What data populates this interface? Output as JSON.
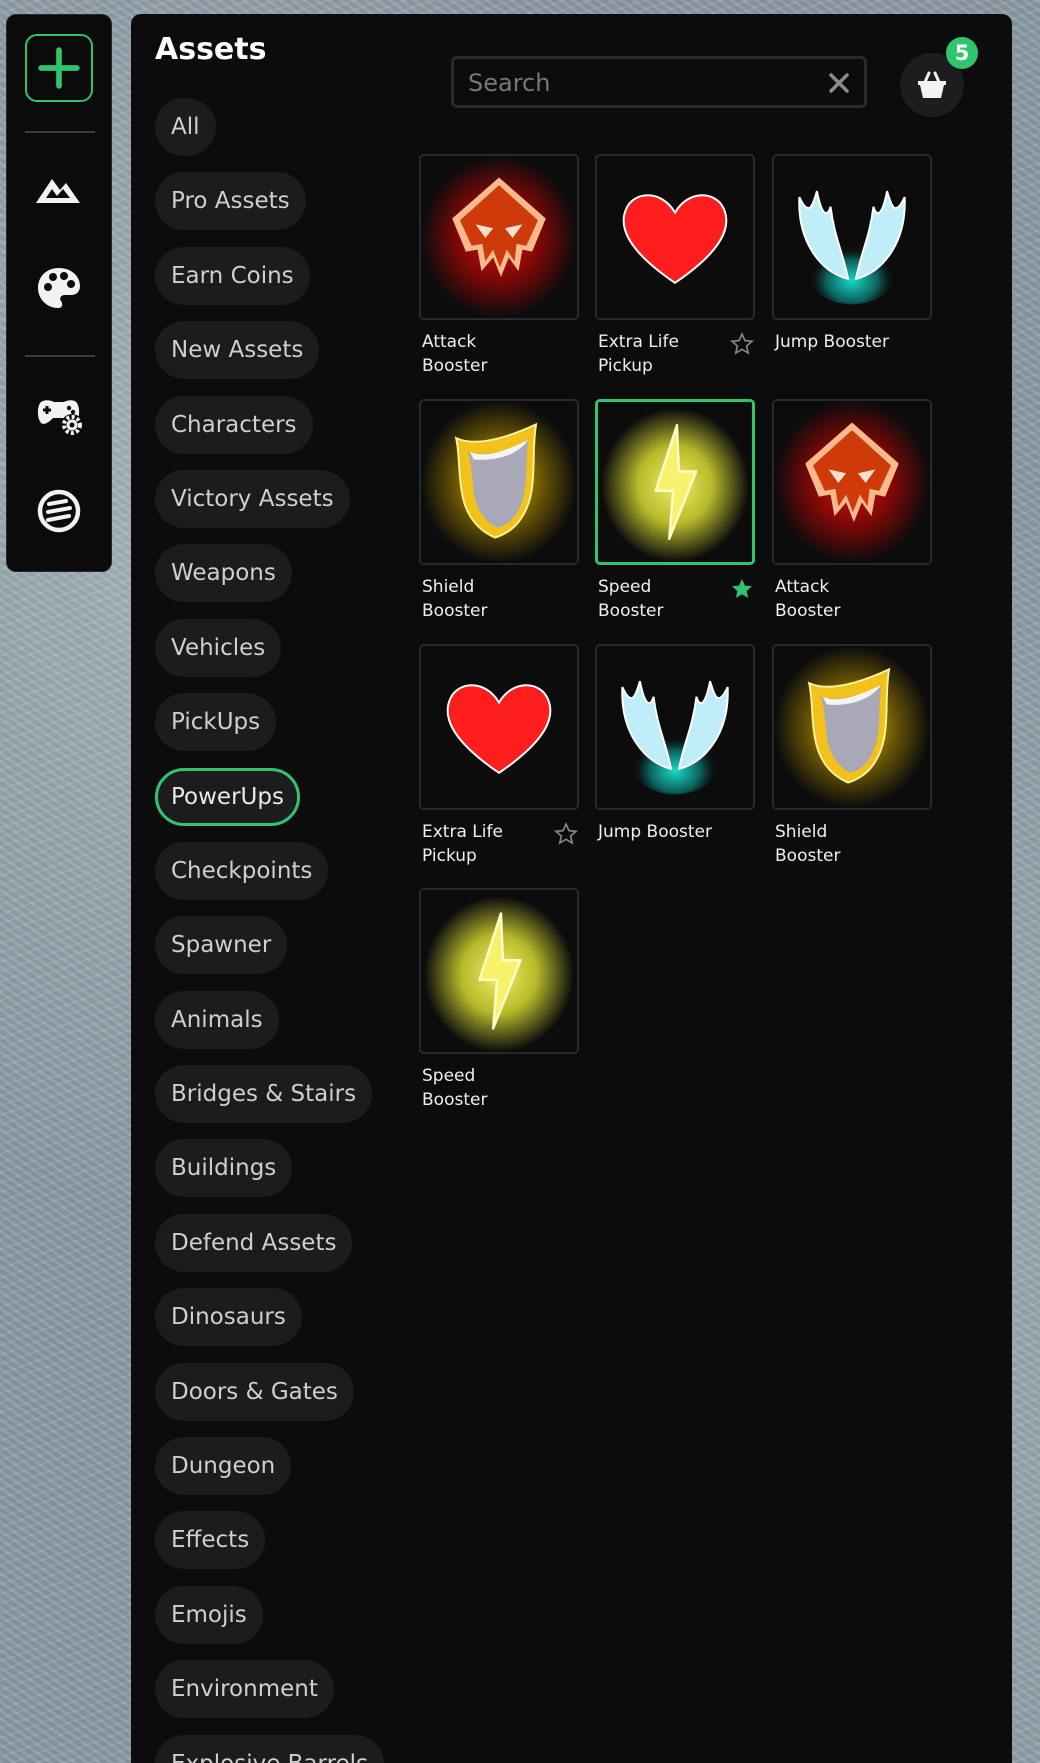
{
  "panel": {
    "title": "Assets"
  },
  "toolbar": {
    "items": [
      {
        "name": "add",
        "icon": "plus-icon"
      },
      {
        "name": "terrain",
        "icon": "mountain-icon"
      },
      {
        "name": "paint",
        "icon": "palette-icon"
      },
      {
        "name": "game-settings",
        "icon": "gamepad-gear-icon"
      },
      {
        "name": "logic",
        "icon": "striped-circle-icon"
      }
    ]
  },
  "categories": [
    {
      "label": "All"
    },
    {
      "label": "Pro Assets"
    },
    {
      "label": "Earn Coins"
    },
    {
      "label": "New Assets"
    },
    {
      "label": "Characters"
    },
    {
      "label": "Victory Assets"
    },
    {
      "label": "Weapons"
    },
    {
      "label": "Vehicles"
    },
    {
      "label": "PickUps"
    },
    {
      "label": "PowerUps",
      "active": true
    },
    {
      "label": "Checkpoints"
    },
    {
      "label": "Spawner"
    },
    {
      "label": "Animals"
    },
    {
      "label": "Bridges & Stairs"
    },
    {
      "label": "Buildings"
    },
    {
      "label": "Defend Assets"
    },
    {
      "label": "Dinosaurs"
    },
    {
      "label": "Doors & Gates"
    },
    {
      "label": "Dungeon"
    },
    {
      "label": "Effects"
    },
    {
      "label": "Emojis"
    },
    {
      "label": "Environment"
    },
    {
      "label": "Explosive Barrels"
    }
  ],
  "search": {
    "placeholder": "Search",
    "value": ""
  },
  "cart": {
    "count": "5",
    "icon": "basket-icon"
  },
  "assets": [
    {
      "name": "Attack Booster",
      "icon": "attack-booster-icon",
      "favorite": null,
      "selected": false
    },
    {
      "name": "Extra Life Pickup",
      "icon": "heart-icon",
      "favorite": false,
      "selected": false
    },
    {
      "name": "Jump Booster",
      "icon": "wings-icon",
      "favorite": null,
      "selected": false
    },
    {
      "name": "Shield Booster",
      "icon": "shield-icon",
      "favorite": null,
      "selected": false
    },
    {
      "name": "Speed Booster",
      "icon": "lightning-icon",
      "favorite": true,
      "selected": true
    },
    {
      "name": "Attack Booster",
      "icon": "attack-booster-icon",
      "favorite": null,
      "selected": false
    },
    {
      "name": "Extra Life Pickup",
      "icon": "heart-icon",
      "favorite": false,
      "selected": false
    },
    {
      "name": "Jump Booster",
      "icon": "wings-icon",
      "favorite": null,
      "selected": false
    },
    {
      "name": "Shield Booster",
      "icon": "shield-icon",
      "favorite": null,
      "selected": false
    },
    {
      "name": "Speed Booster",
      "icon": "lightning-icon",
      "favorite": null,
      "selected": false
    }
  ],
  "colors": {
    "accent": "#2fc46e",
    "panel_bg": "#0c0c0d",
    "chip_bg": "#1c1c1e",
    "favorite_on": "#2fc46e",
    "favorite_off": "#8a8a8a"
  }
}
